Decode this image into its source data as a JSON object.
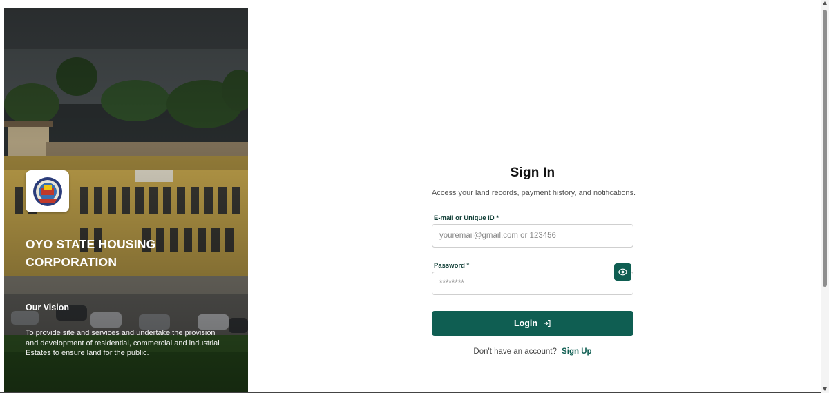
{
  "hero": {
    "org_name": "OYO STATE HOUSING CORPORATION",
    "vision_title": "Our Vision",
    "vision_text": "To provide site and services and undertake the provision and development of residential, commercial and industrial Estates to ensure land for the public.",
    "logo_icon": "oyo-state-seal-logo"
  },
  "form": {
    "title": "Sign In",
    "subtitle": "Access your land records, payment history, and notifications.",
    "email_label": "E-mail or Unique ID *",
    "email_placeholder": "youremail@gmail.com or 123456",
    "password_label": "Password *",
    "password_placeholder": "********",
    "password_toggle_icon": "eye-icon",
    "login_label": "Login",
    "login_icon": "login-arrow-icon",
    "signup_prompt": "Don't have an account?",
    "signup_link": "Sign Up"
  },
  "colors": {
    "primary": "#0f5e52",
    "label": "#0f3d35"
  }
}
